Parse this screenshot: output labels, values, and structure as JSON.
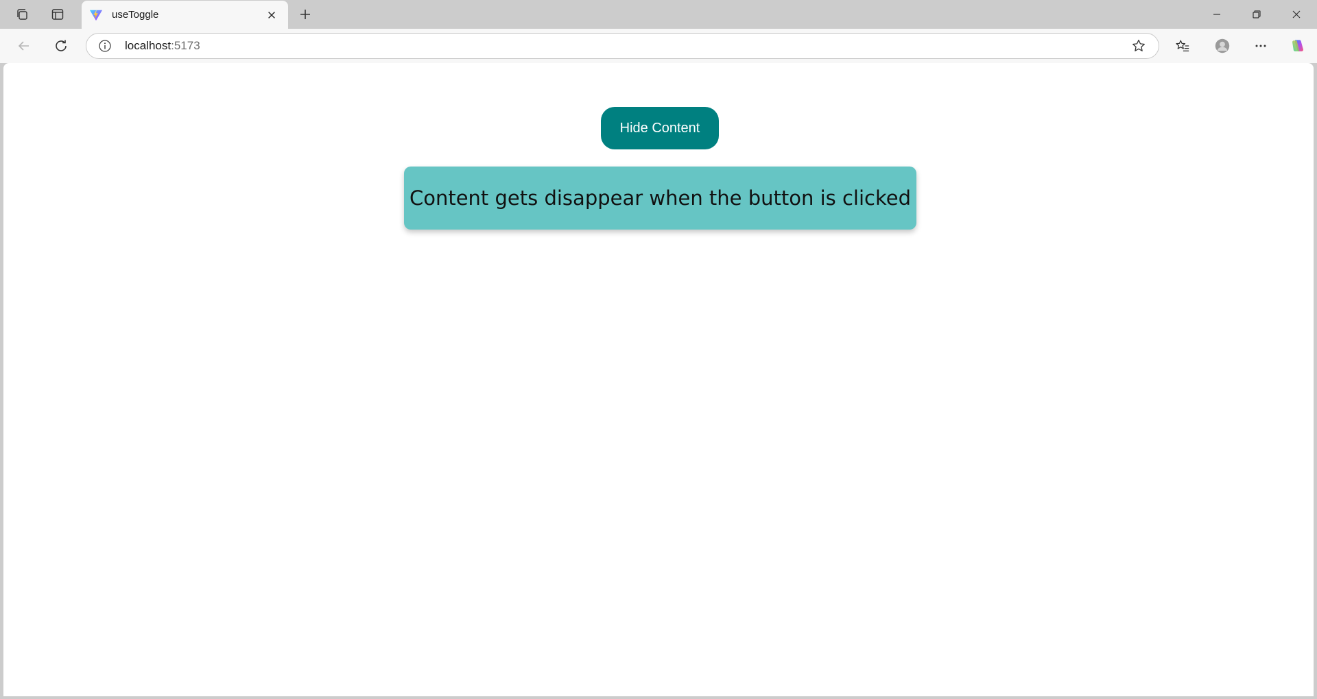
{
  "browser": {
    "tab": {
      "title": "useToggle",
      "favicon": "vite-logo-icon"
    },
    "address_bar": {
      "host": "localhost",
      "port": ":5173"
    }
  },
  "page": {
    "toggle_button_label": "Hide Content",
    "content_text": "Content gets disappear when the button is clicked"
  },
  "colors": {
    "button_bg": "#008080",
    "content_bg": "#66c5c4",
    "chrome_bg": "#cccccc",
    "toolbar_bg": "#f7f7f7"
  }
}
